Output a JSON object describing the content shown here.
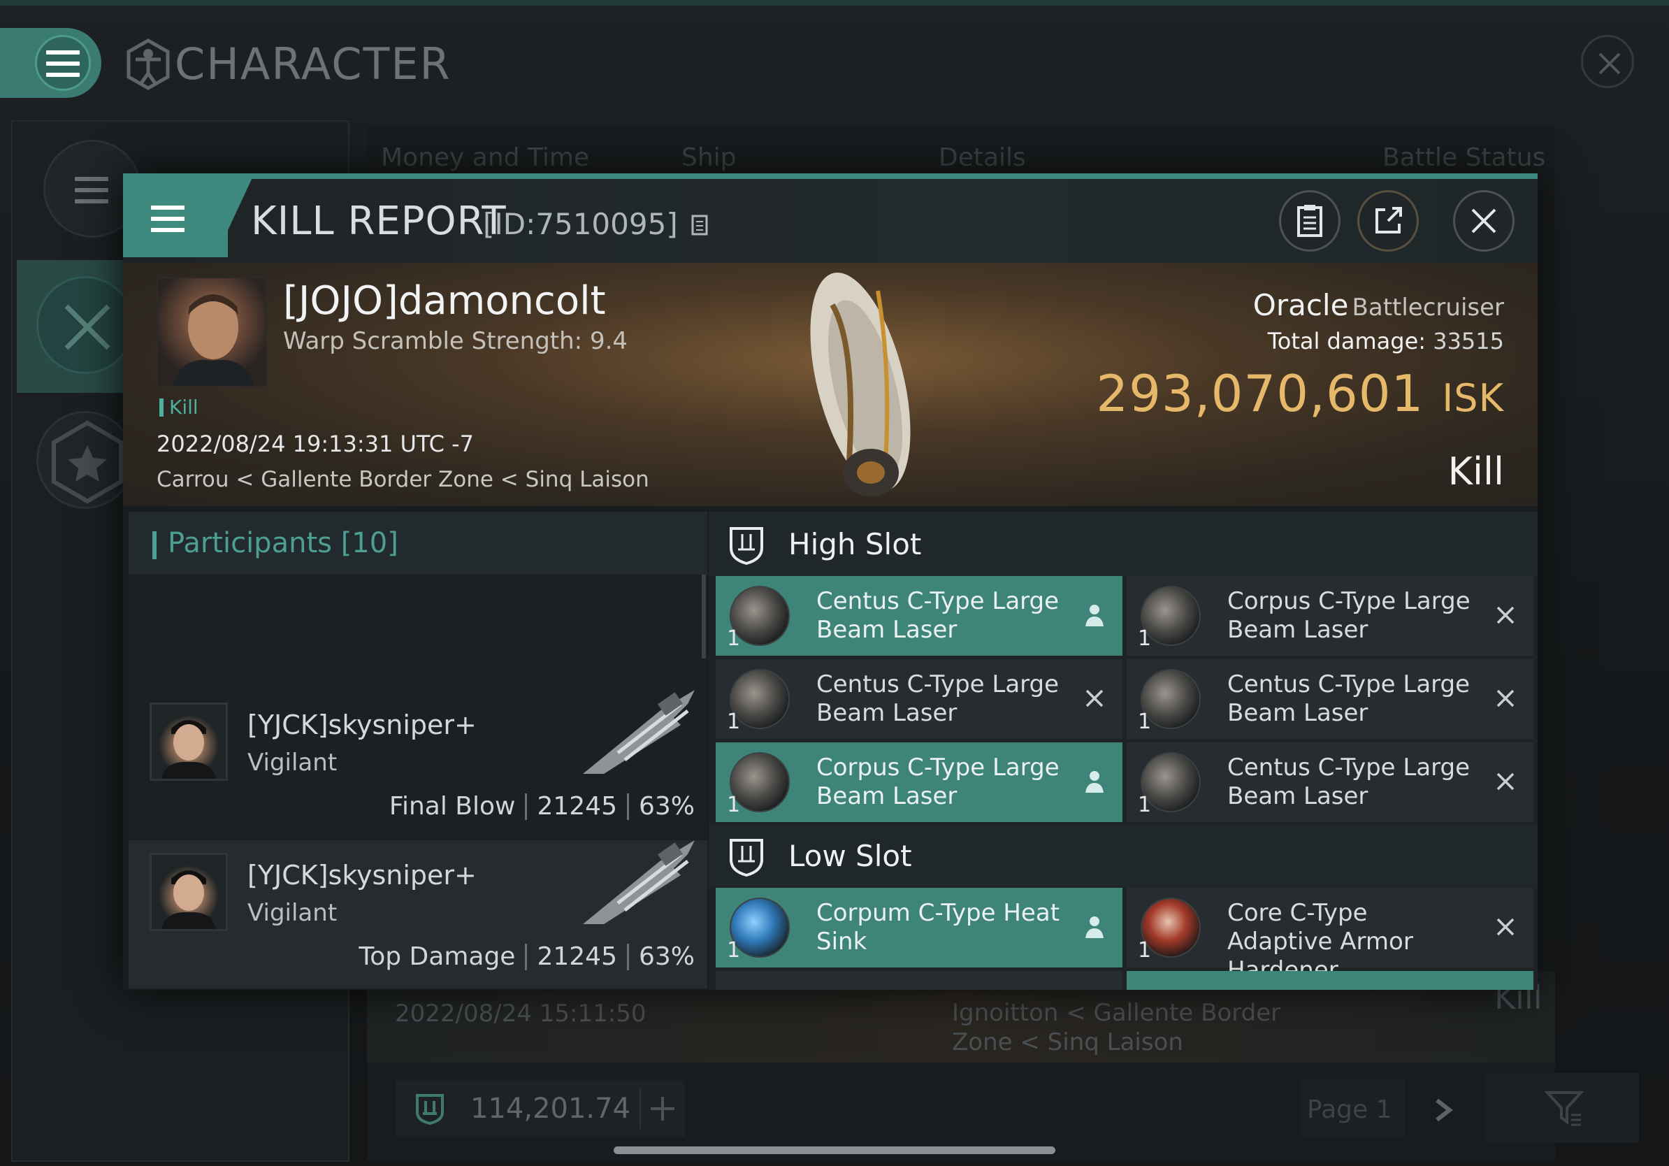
{
  "background": {
    "title": "CHARACTER",
    "tabs": [
      "Money and Time",
      "Ship",
      "Details",
      "Battle Status"
    ],
    "row_date": "2022/08/24  15:11:50",
    "row_location": "Ignoitton < Gallente Border Zone < Sinq Laison",
    "row_result": "Kill",
    "balance": "114,201.74",
    "page": "Page 1"
  },
  "kill_report": {
    "title": "KILL REPORT",
    "id": "[ID:7510095]",
    "victim": {
      "name": "[JOJO]damoncolt",
      "warp_scramble": "Warp Scramble Strength: 9.4",
      "tag": "Kill",
      "datetime": "2022/08/24 19:13:31 UTC -7",
      "location": "Carrou < Gallente Border Zone < Sinq Laison"
    },
    "ship": {
      "name": "Oracle",
      "class": "Battlecruiser",
      "damage_label": "Total damage:",
      "damage_value": "33515",
      "isk_value": "293,070,601",
      "isk_unit": "ISK",
      "result": "Kill"
    },
    "participants": {
      "label": "Participants",
      "count": "[10]",
      "rows": [
        {
          "name": "[YJCK]skysniper+",
          "ship": "Vigilant",
          "role": "Final Blow",
          "damage": "21245",
          "percent": "63%"
        },
        {
          "name": "[YJCK]skysniper+",
          "ship": "Vigilant",
          "role": "Top Damage",
          "damage": "21245",
          "percent": "63%"
        }
      ]
    },
    "high_slot": {
      "label": "High Slot",
      "modules": [
        {
          "name": "Centus C-Type Large Beam Laser",
          "qty": "1",
          "state": "dropped"
        },
        {
          "name": "Corpus C-Type Large Beam Laser",
          "qty": "1",
          "state": "destroyed"
        },
        {
          "name": "Centus C-Type Large Beam Laser",
          "qty": "1",
          "state": "destroyed"
        },
        {
          "name": "Centus C-Type Large Beam Laser",
          "qty": "1",
          "state": "destroyed"
        },
        {
          "name": "Corpus C-Type Large Beam Laser",
          "qty": "1",
          "state": "dropped"
        },
        {
          "name": "Centus C-Type Large Beam Laser",
          "qty": "1",
          "state": "destroyed"
        }
      ]
    },
    "low_slot": {
      "label": "Low Slot",
      "modules": [
        {
          "name": "Corpum C-Type Heat Sink",
          "qty": "1",
          "state": "dropped"
        },
        {
          "name": "Core C-Type Adaptive Armor Hardener",
          "qty": "1",
          "state": "destroyed"
        }
      ]
    }
  },
  "colors": {
    "accent": "#3f8a7f",
    "isk": "#e6b86a"
  }
}
